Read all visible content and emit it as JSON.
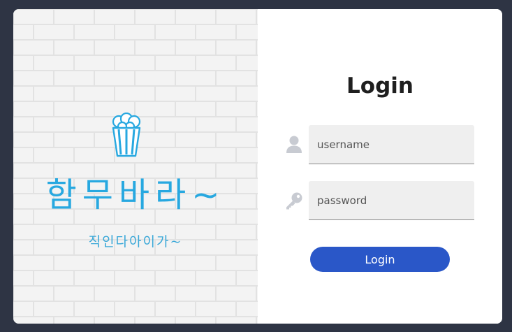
{
  "brand": {
    "title": "함무바라~",
    "subtitle": "직인다아이가~",
    "logo_icon": "popcorn-icon",
    "accent_color": "#27a8e0"
  },
  "login": {
    "heading": "Login",
    "username": {
      "icon": "user-icon",
      "placeholder": "username",
      "value": ""
    },
    "password": {
      "icon": "key-icon",
      "placeholder": "password",
      "value": ""
    },
    "submit_label": "Login",
    "button_color": "#2a57c8"
  },
  "colors": {
    "page_background": "#2e3444",
    "card_background": "#ffffff",
    "input_background": "#efefef",
    "icon_color": "#c8cbd2"
  }
}
